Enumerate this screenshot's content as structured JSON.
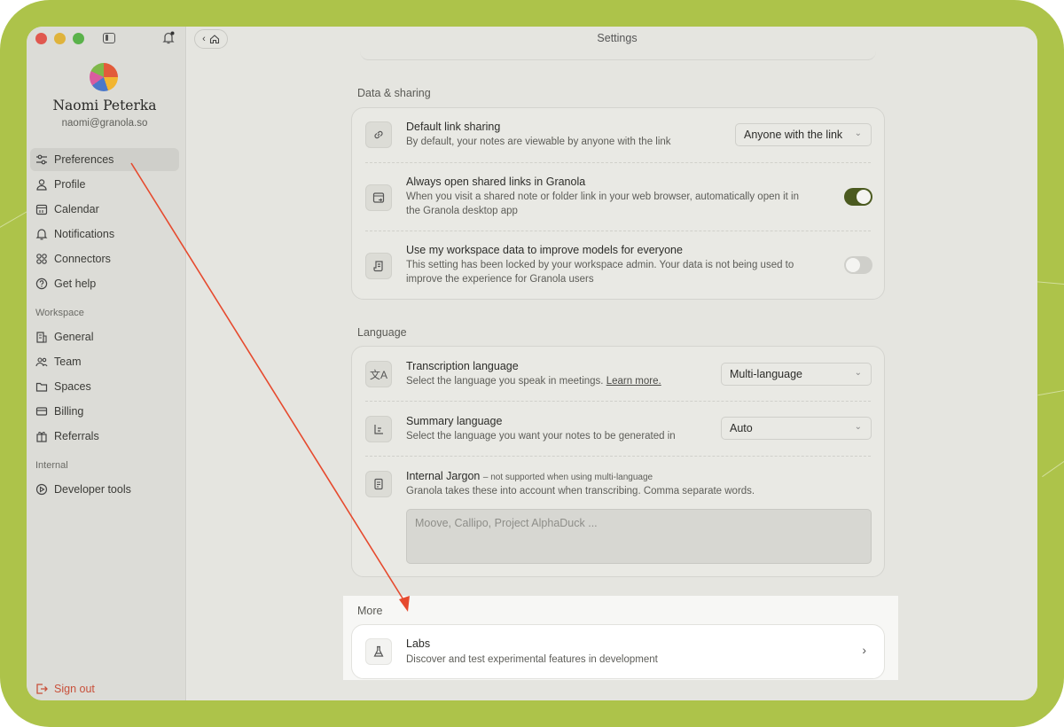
{
  "window": {
    "title": "Settings"
  },
  "user": {
    "name": "Naomi Peterka",
    "email": "naomi@granola.so"
  },
  "sidebar": {
    "items": [
      {
        "label": "Preferences",
        "icon": "sliders-icon",
        "active": true
      },
      {
        "label": "Profile",
        "icon": "person-icon"
      },
      {
        "label": "Calendar",
        "icon": "calendar-icon"
      },
      {
        "label": "Notifications",
        "icon": "bell-icon"
      },
      {
        "label": "Connectors",
        "icon": "connectors-icon"
      },
      {
        "label": "Get help",
        "icon": "help-icon"
      }
    ],
    "workspace_label": "Workspace",
    "workspace_items": [
      {
        "label": "General",
        "icon": "building-icon"
      },
      {
        "label": "Team",
        "icon": "team-icon"
      },
      {
        "label": "Spaces",
        "icon": "folder-icon"
      },
      {
        "label": "Billing",
        "icon": "card-icon"
      },
      {
        "label": "Referrals",
        "icon": "gift-icon"
      }
    ],
    "internal_label": "Internal",
    "internal_items": [
      {
        "label": "Developer tools",
        "icon": "dev-tools-icon"
      }
    ],
    "sign_out": "Sign out"
  },
  "data_sharing": {
    "header": "Data & sharing",
    "default_link": {
      "title": "Default link sharing",
      "desc": "By default, your notes are viewable by anyone with the link",
      "value": "Anyone with the link"
    },
    "always_open": {
      "title": "Always open shared links in Granola",
      "desc_1": "When you visit a shared note or folder link in your web browser, automatically open it in",
      "desc_2": "the Granola desktop app",
      "enabled": true
    },
    "workspace_data": {
      "title": "Use my workspace data to improve models for everyone",
      "desc_1": "This setting has been locked by your workspace admin. Your data is not being used to",
      "desc_2": "improve the experience for Granola users",
      "enabled": false
    }
  },
  "language": {
    "header": "Language",
    "transcription": {
      "title": "Transcription language",
      "desc": "Select the language you speak in meetings.",
      "link": "Learn more.",
      "value": "Multi-language"
    },
    "summary": {
      "title": "Summary language",
      "desc": "Select the language you want your notes to be generated in",
      "value": "Auto"
    },
    "jargon": {
      "title": "Internal Jargon",
      "note": "– not supported when using multi-language",
      "desc": "Granola takes these into account when transcribing. Comma separate words.",
      "placeholder": "Moove, Callipo, Project AlphaDuck ..."
    }
  },
  "more": {
    "header": "More",
    "labs": {
      "title": "Labs",
      "desc": "Discover and test experimental features in development",
      "chevron": "›"
    }
  },
  "colors": {
    "background": "#adc34a",
    "toggle_on": "#4b5a1f",
    "annotation_arrow": "#e64a2e",
    "sign_out": "#c8503a"
  }
}
